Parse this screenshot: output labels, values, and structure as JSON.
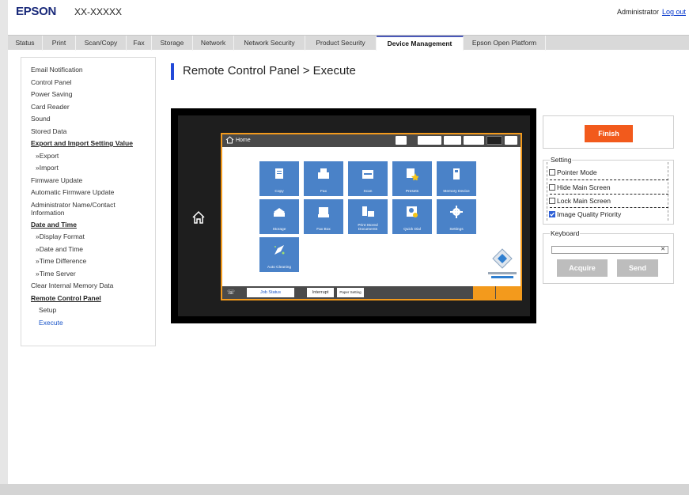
{
  "header": {
    "brand": "EPSON",
    "model": "XX-XXXXX",
    "user": "Administrator",
    "logout": "Log out"
  },
  "tabs": [
    {
      "label": "Status"
    },
    {
      "label": "Print"
    },
    {
      "label": "Scan/Copy"
    },
    {
      "label": "Fax"
    },
    {
      "label": "Storage"
    },
    {
      "label": "Network"
    },
    {
      "label": "Network Security"
    },
    {
      "label": "Product Security"
    },
    {
      "label": "Device Management",
      "active": true
    },
    {
      "label": "Epson Open Platform"
    }
  ],
  "sidebar": {
    "items": [
      {
        "label": "Email Notification"
      },
      {
        "label": "Control Panel"
      },
      {
        "label": "Power Saving"
      },
      {
        "label": "Card Reader"
      },
      {
        "label": "Sound"
      },
      {
        "label": "Stored Data"
      },
      {
        "label": "Export and Import Setting Value"
      },
      {
        "label": "»Export"
      },
      {
        "label": "»Import"
      },
      {
        "label": "Firmware Update"
      },
      {
        "label": "Automatic Firmware Update"
      },
      {
        "label": "Administrator Name/Contact Information"
      },
      {
        "label": "Date and Time"
      },
      {
        "label": "»Display Format"
      },
      {
        "label": "»Date and Time"
      },
      {
        "label": "»Time Difference"
      },
      {
        "label": "»Time Server"
      },
      {
        "label": "Clear Internal Memory Data"
      },
      {
        "label": "Remote Control Panel"
      },
      {
        "label": "Setup"
      },
      {
        "label": "Execute"
      }
    ]
  },
  "page": {
    "title": "Remote Control Panel > Execute"
  },
  "panel": {
    "home_label": "Home",
    "tiles": [
      {
        "label": "Copy",
        "icon": "copy-icon"
      },
      {
        "label": "Fax",
        "icon": "fax-icon"
      },
      {
        "label": "Scan",
        "icon": "scan-icon"
      },
      {
        "label": "Presets",
        "icon": "presets-icon"
      },
      {
        "label": "Memory Device",
        "icon": "memory-device-icon"
      },
      {
        "label": "Storage",
        "icon": "storage-icon"
      },
      {
        "label": "Fax Box",
        "icon": "fax-box-icon"
      },
      {
        "label": "Print Stored Documents",
        "icon": "print-stored-icon"
      },
      {
        "label": "Quick Dial",
        "icon": "quick-dial-icon"
      },
      {
        "label": "Settings",
        "icon": "gear-icon"
      },
      {
        "label": "Auto Cleaning",
        "icon": "auto-cleaning-icon"
      }
    ],
    "bottom": {
      "job_status": "Job Status",
      "interrupt": "Interrupt",
      "paper_setting": "Paper Setting"
    },
    "tile_color": "#4a82c8",
    "accent_color": "#f39a1c"
  },
  "controls": {
    "finish": "Finish",
    "setting_title": "Setting",
    "options": [
      {
        "label": "Pointer Mode",
        "checked": false
      },
      {
        "label": "Hide Main Screen",
        "checked": false
      },
      {
        "label": "Lock Main Screen",
        "checked": false
      },
      {
        "label": "Image Quality Priority",
        "checked": true
      }
    ],
    "keyboard_title": "Keyboard",
    "keyboard_value": "",
    "acquire": "Acquire",
    "send": "Send",
    "finish_color": "#f25a1c"
  }
}
